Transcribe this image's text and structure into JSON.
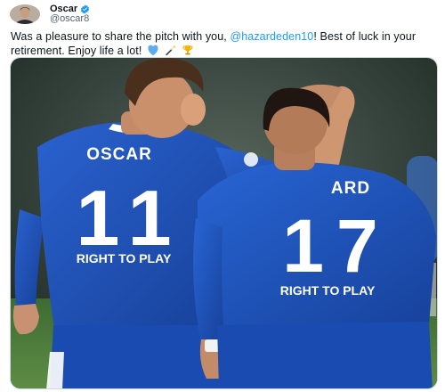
{
  "author": {
    "display_name": "Oscar",
    "handle": "@oscar8",
    "verified": true,
    "avatar_icon": "avatar-photo"
  },
  "tweet": {
    "text_before": "Was a pleasure to share the pitch with you, ",
    "mention": "@hazardeden10",
    "text_after": "! Best of luck in your retirement. Enjoy life a lot!",
    "emojis": [
      "blue-heart-icon",
      "magic-wand-icon",
      "trophy-icon"
    ]
  },
  "photo": {
    "left_player": {
      "name": "OSCAR",
      "number": "11",
      "sponsor": "RIGHT TO PLAY"
    },
    "right_player": {
      "name": "ARD",
      "number": "17",
      "sponsor": "RIGHT TO PLAY"
    },
    "colors": {
      "kit_blue": "#1a4fb8",
      "kit_dark": "#123a8c",
      "pitch": "#4a7a3a",
      "background": "#2b3a33"
    }
  },
  "colors": {
    "link": "#1d9bf0",
    "verified": "#1d9bf0",
    "muted": "#536471"
  }
}
